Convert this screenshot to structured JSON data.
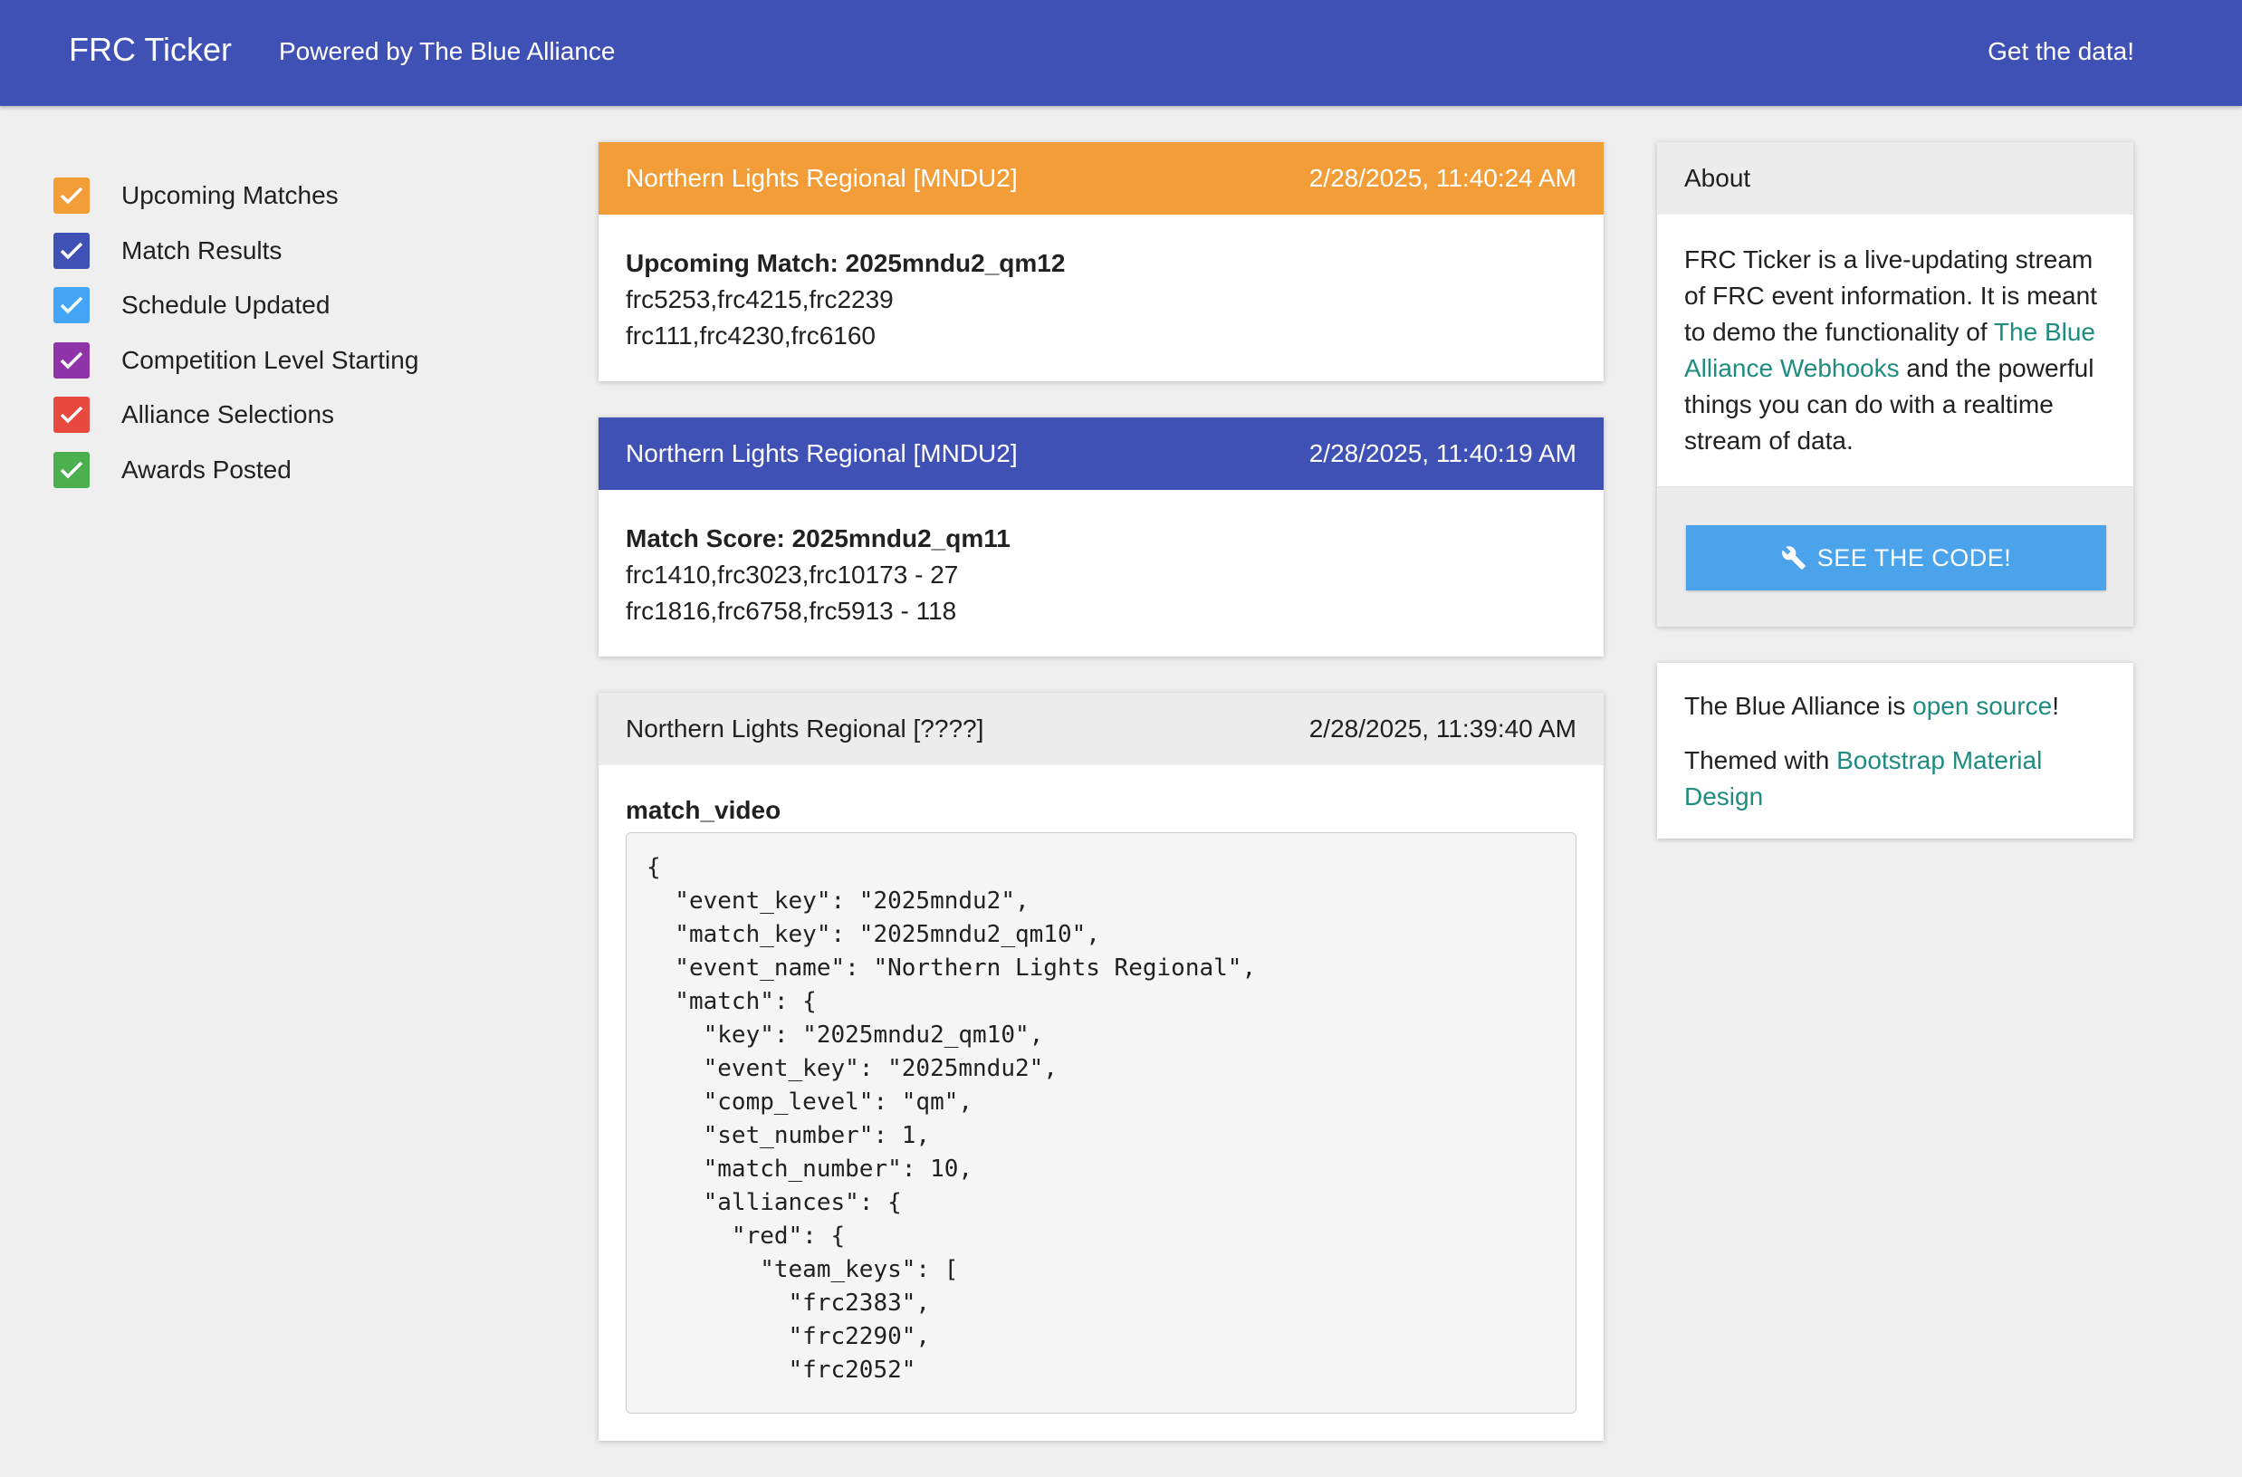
{
  "navbar": {
    "brand": "FRC Ticker",
    "powered_by": "Powered by The Blue Alliance",
    "get_data": "Get the data!"
  },
  "filters": [
    {
      "label": "Upcoming Matches",
      "color": "#f29d38",
      "checked": true
    },
    {
      "label": "Match Results",
      "color": "#3f51b5",
      "checked": true
    },
    {
      "label": "Schedule Updated",
      "color": "#42a5f5",
      "checked": true
    },
    {
      "label": "Competition Level Starting",
      "color": "#8e34a8",
      "checked": true
    },
    {
      "label": "Alliance Selections",
      "color": "#e8483e",
      "checked": true
    },
    {
      "label": "Awards Posted",
      "color": "#4caf50",
      "checked": true
    }
  ],
  "feed": [
    {
      "event": "Northern Lights Regional [MNDU2]",
      "timestamp": "2/28/2025, 11:40:24 AM",
      "header_color": "#f29d38",
      "title": "Upcoming Match: 2025mndu2_qm12",
      "lines": [
        "frc5253,frc4215,frc2239",
        "frc111,frc4230,frc6160"
      ]
    },
    {
      "event": "Northern Lights Regional [MNDU2]",
      "timestamp": "2/28/2025, 11:40:19 AM",
      "header_color": "#3f51b5",
      "title": "Match Score: 2025mndu2_qm11",
      "lines": [
        "frc1410,frc3023,frc10173 - 27",
        "frc1816,frc6758,frc5913 - 118"
      ]
    },
    {
      "event": "Northern Lights Regional [????]",
      "timestamp": "2/28/2025, 11:39:40 AM",
      "header_color": "#ececec",
      "title": "match_video",
      "code": "{\n  \"event_key\": \"2025mndu2\",\n  \"match_key\": \"2025mndu2_qm10\",\n  \"event_name\": \"Northern Lights Regional\",\n  \"match\": {\n    \"key\": \"2025mndu2_qm10\",\n    \"event_key\": \"2025mndu2\",\n    \"comp_level\": \"qm\",\n    \"set_number\": 1,\n    \"match_number\": 10,\n    \"alliances\": {\n      \"red\": {\n        \"team_keys\": [\n          \"frc2383\",\n          \"frc2290\",\n          \"frc2052\""
    }
  ],
  "about": {
    "title": "About",
    "text_1": "FRC Ticker is a live-updating stream of FRC event information. It is meant to demo the functionality of ",
    "link_1": "The Blue Alliance Webhooks",
    "text_2": " and the powerful things you can do with a realtime stream of data.",
    "button_label": "SEE THE CODE!",
    "button_icon": "wrench-icon"
  },
  "info": {
    "tba_text": "The Blue Alliance is ",
    "tba_link": "open source",
    "tba_suffix": "!",
    "theme_text": "Themed with ",
    "theme_link": "Bootstrap Material Design"
  }
}
